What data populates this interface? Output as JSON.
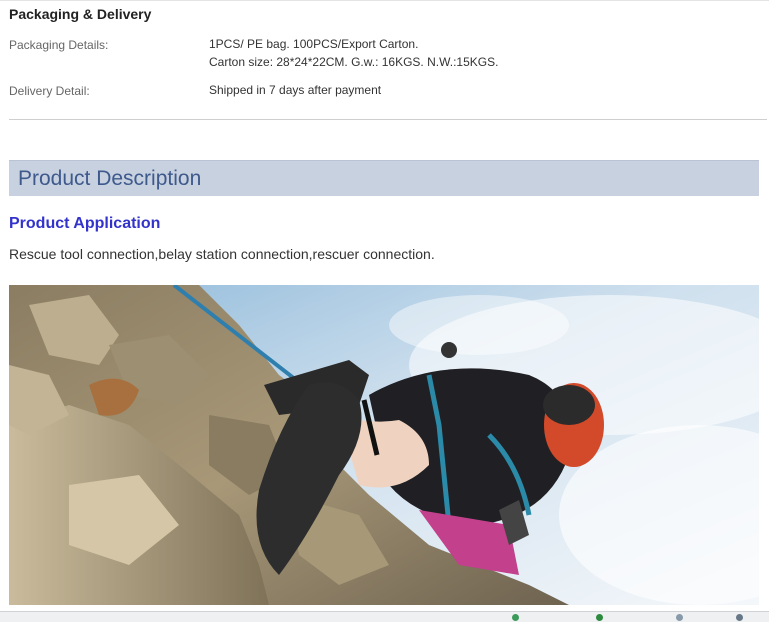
{
  "packaging_delivery": {
    "title": "Packaging & Delivery",
    "packaging_label": "Packaging Details:",
    "packaging_line1": "1PCS/ PE bag. 100PCS/Export Carton.",
    "packaging_line2": "Carton size: 28*24*22CM. G.w.: 16KGS. N.W.:15KGS.",
    "delivery_label": "Delivery Detail:",
    "delivery_value": "Shipped in 7 days after payment"
  },
  "product_description": {
    "header": "Product Description",
    "application_title": "Product Application",
    "application_text": "Rescue tool connection,belay station connection,rescuer connection."
  },
  "hero_image": {
    "subject": "climber on rock face with rope"
  },
  "colors": {
    "header_bg": "#c8d1e0",
    "header_text": "#3e5a8c",
    "application_title": "#3333cc"
  }
}
